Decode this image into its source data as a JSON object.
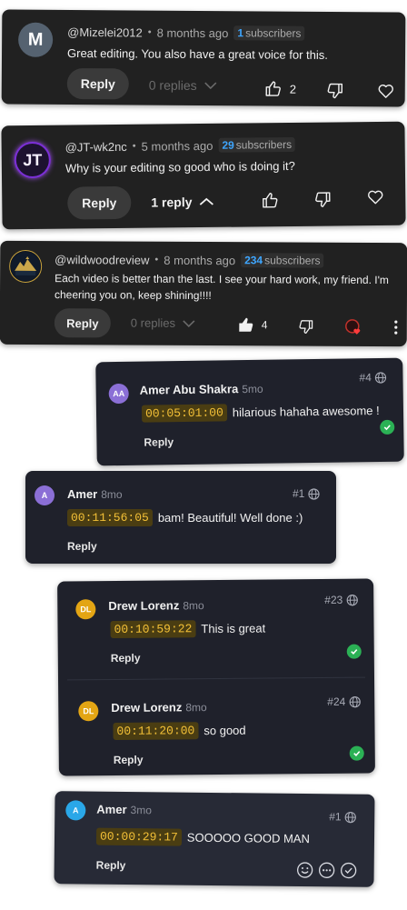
{
  "youtube_comments": [
    {
      "avatar_letter": "M",
      "avatar_color": "#556270",
      "handle": "@Mizelei2012",
      "time": "8 months ago",
      "subscribers_count": "1",
      "subscribers_label": "subscribers",
      "text": "Great editing. You also have a great voice for this.",
      "reply_label": "Reply",
      "replies_label": "0 replies",
      "like_count": "2"
    },
    {
      "avatar_letter": "JT",
      "avatar_color": "#1d1230",
      "handle": "@JT-wk2nc",
      "time": "5 months ago",
      "subscribers_count": "29",
      "subscribers_label": "subscribers",
      "text": "Why is your editing so good who is doing it?",
      "reply_label": "Reply",
      "replies_label": "1 reply"
    },
    {
      "avatar_logo_text": "WILDWOOD REVIEW",
      "handle": "@wildwoodreview",
      "time": "8 months ago",
      "subscribers_count": "234",
      "subscribers_label": "subscribers",
      "text": "Each video is better than the last. I see your hard work, my friend. I'm cheering you on, keep shining!!!!",
      "reply_label": "Reply",
      "replies_label": "0 replies",
      "like_count": "4"
    }
  ],
  "frame_comments": [
    {
      "initials": "AA",
      "avatar_color": "#8b6fd6",
      "name": "Amer Abu Shakra",
      "age": "5mo",
      "number": "#4",
      "timecode": "00:05:01:00",
      "message": "hilarious hahaha awesome !",
      "reply_label": "Reply"
    },
    {
      "initials": "A",
      "avatar_color": "#8b6fd6",
      "name": "Amer",
      "age": "8mo",
      "number": "#1",
      "timecode": "00:11:56:05",
      "message": "bam! Beautiful! Well done :)",
      "reply_label": "Reply"
    },
    {
      "initials": "DL",
      "avatar_color": "#e3a514",
      "name": "Drew Lorenz",
      "age": "8mo",
      "number": "#23",
      "timecode": "00:10:59:22",
      "message": "This is great",
      "reply_label": "Reply"
    },
    {
      "initials": "DL",
      "avatar_color": "#e3a514",
      "name": "Drew Lorenz",
      "age": "8mo",
      "number": "#24",
      "timecode": "00:11:20:00",
      "message": "so good",
      "reply_label": "Reply"
    },
    {
      "initials": "A",
      "avatar_color": "#2aa7e8",
      "name": "Amer",
      "age": "3mo",
      "number": "#1",
      "timecode": "00:00:29:17",
      "message": "SOOOOO GOOD MAN",
      "reply_label": "Reply"
    }
  ]
}
